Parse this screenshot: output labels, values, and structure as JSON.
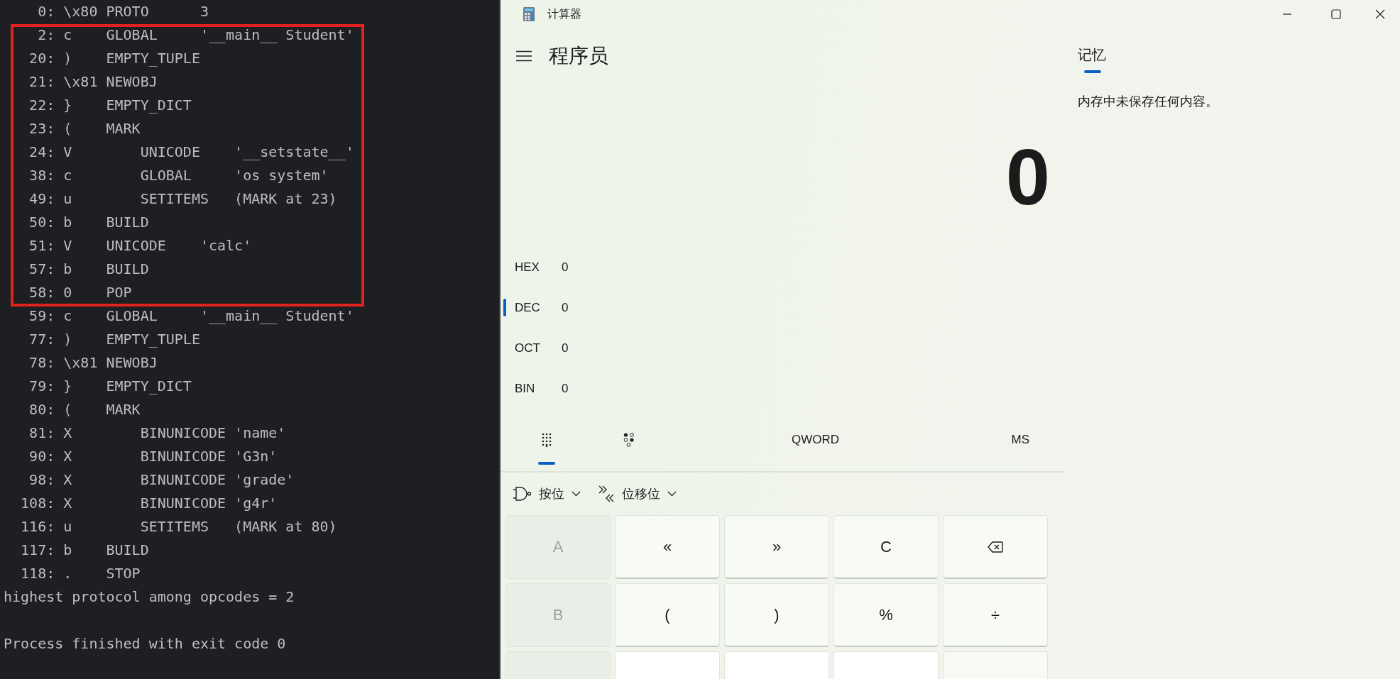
{
  "terminal": {
    "lines": [
      "    0: \\x80 PROTO      3"
    ],
    "highlight_box": {
      "lines": [
        "    2: c    GLOBAL     '__main__ Student'",
        "   20: )    EMPTY_TUPLE",
        "   21: \\x81 NEWOBJ",
        "   22: }    EMPTY_DICT",
        "   23: (    MARK",
        "   24: V        UNICODE    '__setstate__'",
        "   38: c        GLOBAL     'os system'",
        "   49: u        SETITEMS   (MARK at 23)",
        "   50: b    BUILD",
        "   51: V    UNICODE    'calc'",
        "   57: b    BUILD",
        "   58: 0    POP"
      ]
    },
    "more_lines": [
      "   59: c    GLOBAL     '__main__ Student'",
      "   77: )    EMPTY_TUPLE",
      "   78: \\x81 NEWOBJ",
      "   79: }    EMPTY_DICT",
      "   80: (    MARK",
      "   81: X        BINUNICODE 'name'",
      "   90: X        BINUNICODE 'G3n'",
      "   98: X        BINUNICODE 'grade'",
      "  108: X        BINUNICODE 'g4r'",
      "  116: u        SETITEMS   (MARK at 80)",
      "  117: b    BUILD",
      "  118: .    STOP"
    ],
    "output": [
      "highest protocol among opcodes = 2",
      "Process finished with exit code 0"
    ]
  },
  "calculator": {
    "window": {
      "title": "计算器"
    },
    "mode": "程序员",
    "display": "0",
    "radix": [
      {
        "label": "HEX",
        "value": "0",
        "selected": false
      },
      {
        "label": "DEC",
        "value": "0",
        "selected": true
      },
      {
        "label": "OCT",
        "value": "0",
        "selected": false
      },
      {
        "label": "BIN",
        "value": "0",
        "selected": false
      }
    ],
    "tabs": [
      {
        "kind": "keypad",
        "selected": true
      },
      {
        "kind": "bits",
        "selected": false
      }
    ],
    "word_size": "QWORD",
    "memory_store": "MS",
    "toolbar": [
      {
        "kind": "bitwise",
        "label": "按位"
      },
      {
        "kind": "shift",
        "label": "位移位"
      }
    ],
    "keys": [
      {
        "kind": "hex",
        "label": "A",
        "disabled": true
      },
      {
        "kind": "op",
        "label": "«",
        "disabled": false
      },
      {
        "kind": "op",
        "label": "»",
        "disabled": false
      },
      {
        "kind": "op",
        "label": "C",
        "disabled": false
      },
      {
        "kind": "backspace",
        "disabled": false
      },
      {
        "kind": "hex",
        "label": "B",
        "disabled": true
      },
      {
        "kind": "op",
        "label": "(",
        "disabled": false
      },
      {
        "kind": "op",
        "label": ")",
        "disabled": false
      },
      {
        "kind": "op",
        "label": "%",
        "disabled": false
      },
      {
        "kind": "op",
        "label": "÷",
        "disabled": false
      },
      {
        "kind": "hex"
      },
      {
        "kind": "digit"
      },
      {
        "kind": "digit"
      },
      {
        "kind": "digit"
      },
      {
        "kind": "op"
      }
    ],
    "memory": {
      "tabs": [
        {
          "label": "记忆",
          "selected": true
        }
      ],
      "empty_text": "内存中未保存任何内容。"
    }
  }
}
